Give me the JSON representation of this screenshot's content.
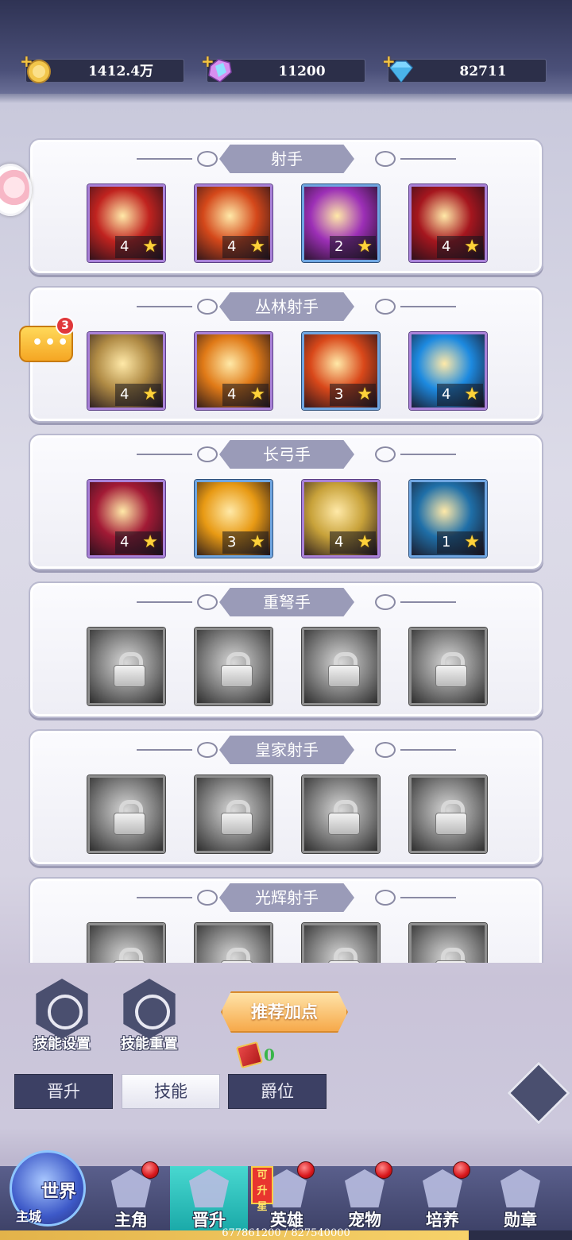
{
  "currencies": [
    {
      "icon": "gold-coin-icon",
      "value": "1412.4万"
    },
    {
      "icon": "rainbow-gem-icon",
      "value": "11200"
    },
    {
      "icon": "blue-diamond-icon",
      "value": "82711"
    }
  ],
  "chat_badge": "3",
  "sections": [
    {
      "title": "射手",
      "skills": [
        {
          "level": "4",
          "frame": "purple",
          "color": "#c0231f"
        },
        {
          "level": "4",
          "frame": "purple",
          "color": "#d4481a"
        },
        {
          "level": "2",
          "frame": "blue",
          "color": "#9c2fb6"
        },
        {
          "level": "4",
          "frame": "purple",
          "color": "#a5161e"
        }
      ]
    },
    {
      "title": "丛林射手",
      "skills": [
        {
          "level": "4",
          "frame": "purple",
          "color": "#b08b45"
        },
        {
          "level": "4",
          "frame": "purple",
          "color": "#e07a17"
        },
        {
          "level": "3",
          "frame": "blue",
          "color": "#d9481a"
        },
        {
          "level": "4",
          "frame": "purple",
          "color": "#1d8ae0"
        }
      ]
    },
    {
      "title": "长弓手",
      "skills": [
        {
          "level": "4",
          "frame": "purple",
          "color": "#a21a35"
        },
        {
          "level": "3",
          "frame": "blue",
          "color": "#e89a14"
        },
        {
          "level": "4",
          "frame": "purple",
          "color": "#c8a23a"
        },
        {
          "level": "1",
          "frame": "blue",
          "color": "#1f6fa8"
        }
      ]
    },
    {
      "title": "重弩手",
      "locked": true,
      "skills": [
        {
          "frame": "grey"
        },
        {
          "frame": "grey"
        },
        {
          "frame": "grey"
        },
        {
          "frame": "grey"
        }
      ]
    },
    {
      "title": "皇家射手",
      "locked": true,
      "skills": [
        {
          "frame": "grey"
        },
        {
          "frame": "grey"
        },
        {
          "frame": "grey"
        },
        {
          "frame": "grey"
        }
      ]
    },
    {
      "title": "光辉射手",
      "locked": true,
      "skills": [
        {
          "frame": "grey"
        },
        {
          "frame": "grey"
        },
        {
          "frame": "grey"
        },
        {
          "frame": "grey"
        }
      ]
    }
  ],
  "controls": {
    "skill_settings": "技能设置",
    "skill_reset": "技能重置",
    "recommend": "推荐加点",
    "book_count": "0"
  },
  "tabs": [
    {
      "label": "晋升",
      "active": false
    },
    {
      "label": "技能",
      "active": true
    },
    {
      "label": "爵位",
      "active": false
    }
  ],
  "nav": {
    "world": "世界",
    "main_city": "主城",
    "items": [
      {
        "label": "主角",
        "dot": true
      },
      {
        "label": "晋升",
        "dot": false,
        "active": true
      },
      {
        "label": "英雄",
        "dot": true
      },
      {
        "label": "宠物",
        "dot": true
      },
      {
        "label": "培养",
        "dot": true
      },
      {
        "label": "勋章",
        "dot": false
      }
    ],
    "upgrade_star": "可升星"
  },
  "experience": {
    "text": "677861200 / 827540000",
    "current": 677861200,
    "max": 827540000
  }
}
